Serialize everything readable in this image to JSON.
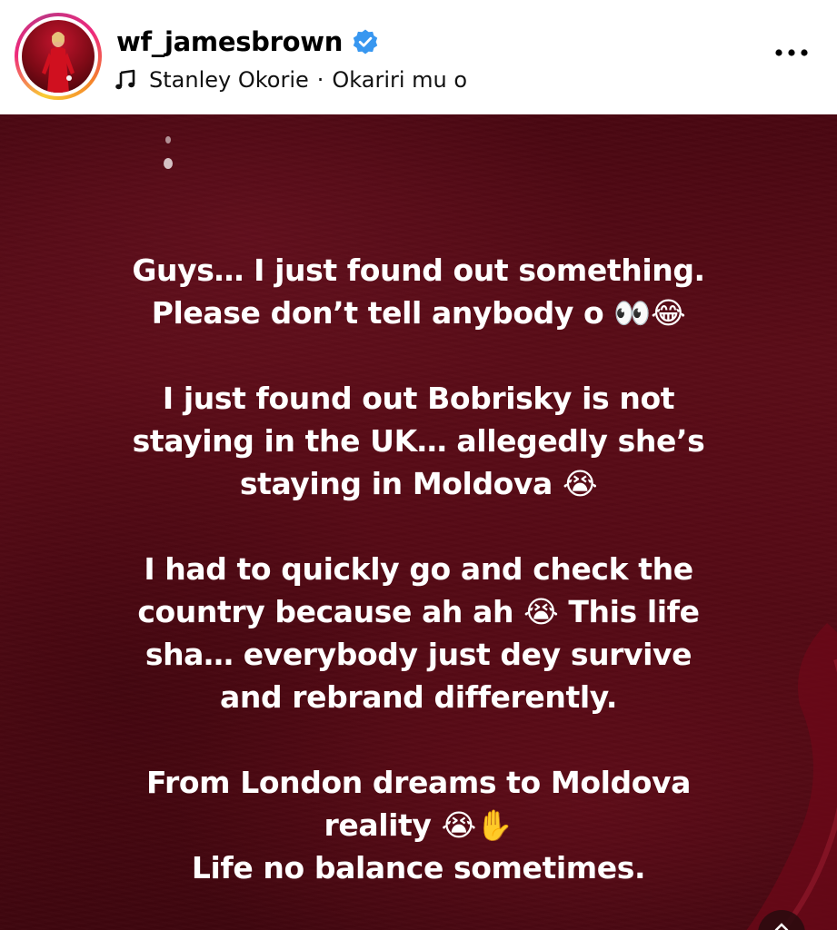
{
  "header": {
    "username": "wf_jamesbrown",
    "verified": true,
    "music": {
      "artist": "Stanley Okorie",
      "separator": "·",
      "song": "Okariri mu o"
    },
    "more_icon": "more-horizontal-icon"
  },
  "story": {
    "background_color": "#520b15",
    "text_color": "#ffffff",
    "paragraphs": [
      "Guys… I just found out something.\nPlease don’t tell anybody o 👀😂",
      "I just found out Bobrisky is not\nstaying in the UK… allegedly she’s\nstaying in Moldova 😭",
      "I had to quickly go and check the\ncountry because ah ah 😭 This life\nsha… everybody just dey survive\nand rebrand differently.",
      "From London dreams to Moldova\nreality 😭✋\nLife no balance sometimes."
    ]
  },
  "colors": {
    "verified_badge": "#3897f0",
    "ring_start": "#f9ce34",
    "ring_mid": "#ee2a7b",
    "ring_end": "#c13584"
  }
}
